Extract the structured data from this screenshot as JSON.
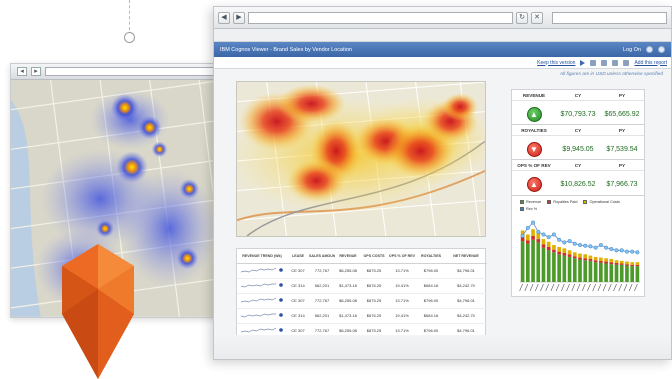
{
  "app": {
    "title": "IBM Cognos Viewer - Brand Sales by Vendor Location",
    "user_link": "Log On",
    "toolbar_keep_version": "Keep this version",
    "toolbar_add_report": "Add this report",
    "note": "All figures are in USD unless otherwise specified"
  },
  "kpis": [
    {
      "label": "REVENUE",
      "col1": "CY",
      "col2": "PY",
      "status": "green",
      "icon": "arrow-up-icon",
      "cy": "$70,793.73",
      "py": "$65,665.92"
    },
    {
      "label": "ROYALTIES",
      "col1": "CY",
      "col2": "PY",
      "status": "red",
      "icon": "arrow-down-icon",
      "cy": "$9,945.05",
      "py": "$7,539.54"
    },
    {
      "label": "OPS % OF REV",
      "col1": "CY",
      "col2": "PY",
      "status": "red",
      "icon": "arrow-up-icon",
      "cy": "$10,826.52",
      "py": "$7,966.73"
    }
  ],
  "chart_legend": [
    {
      "label": "Revenue",
      "color": "#4c9a2a"
    },
    {
      "label": "Royalties Paid",
      "color": "#c9302c"
    },
    {
      "label": "Operational Costs",
      "color": "#e0b000"
    },
    {
      "label": "Rev %",
      "color": "#3a7fc4"
    }
  ],
  "table": {
    "headers": [
      "REVENUE TREND (Wk)",
      "LEASE",
      "SALES AMOUNT",
      "REVENUE",
      "OPS COSTS",
      "OPS % OF REV",
      "ROYALTIES",
      "NET REVENUE"
    ],
    "rows": [
      [
        "",
        "CE 307",
        "772,767",
        "$6,255.08",
        "$875.25",
        "13.71%",
        "$796.00",
        "$4,796.01"
      ],
      [
        "",
        "CE 314",
        "562,201",
        "$1,473.18",
        "$676.25",
        "19.41%",
        "$684.16",
        "$4,242.70"
      ],
      [
        "",
        "CE 307",
        "772,767",
        "$6,255.08",
        "$875.25",
        "13.71%",
        "$796.00",
        "$4,796.01"
      ],
      [
        "",
        "CE 314",
        "562,201",
        "$1,473.18",
        "$676.25",
        "19.41%",
        "$684.16",
        "$4,242.70"
      ],
      [
        "",
        "CE 307",
        "772,767",
        "$6,255.08",
        "$875.25",
        "13.71%",
        "$796.00",
        "$4,796.01"
      ],
      [
        "",
        "CE 314",
        "562,201",
        "$1,473.18",
        "$676.25",
        "19.41%",
        "$684.16",
        "$4,242.70"
      ]
    ]
  },
  "chart_data": {
    "type": "bar",
    "title": "",
    "xlabel": "",
    "ylabel": "",
    "stacked": true,
    "categories": [
      "c1",
      "c2",
      "c3",
      "c4",
      "c5",
      "c6",
      "c7",
      "c8",
      "c9",
      "c10",
      "c11",
      "c12",
      "c13",
      "c14",
      "c15",
      "c16",
      "c17",
      "c18",
      "c19",
      "c20",
      "c21",
      "c22",
      "c23"
    ],
    "series": [
      {
        "name": "Revenue",
        "values": [
          62,
          58,
          64,
          60,
          52,
          48,
          45,
          42,
          40,
          38,
          36,
          34,
          33,
          32,
          30,
          29,
          28,
          27,
          26,
          26,
          25,
          24,
          24
        ]
      },
      {
        "name": "Royalties Paid",
        "values": [
          6,
          5,
          6,
          5,
          5,
          5,
          4,
          4,
          4,
          4,
          3,
          3,
          3,
          3,
          3,
          3,
          3,
          3,
          3,
          2,
          2,
          2,
          2
        ]
      },
      {
        "name": "Operational Costs",
        "values": [
          10,
          9,
          10,
          9,
          8,
          8,
          7,
          7,
          7,
          6,
          6,
          6,
          6,
          5,
          5,
          5,
          5,
          5,
          4,
          4,
          4,
          4,
          4
        ]
      },
      {
        "name": "Rev %",
        "values": [
          70,
          82,
          90,
          76,
          72,
          68,
          72,
          64,
          60,
          62,
          58,
          56,
          55,
          54,
          52,
          56,
          52,
          50,
          48,
          48,
          46,
          46,
          45
        ]
      }
    ],
    "ylim": [
      0,
      100
    ]
  }
}
